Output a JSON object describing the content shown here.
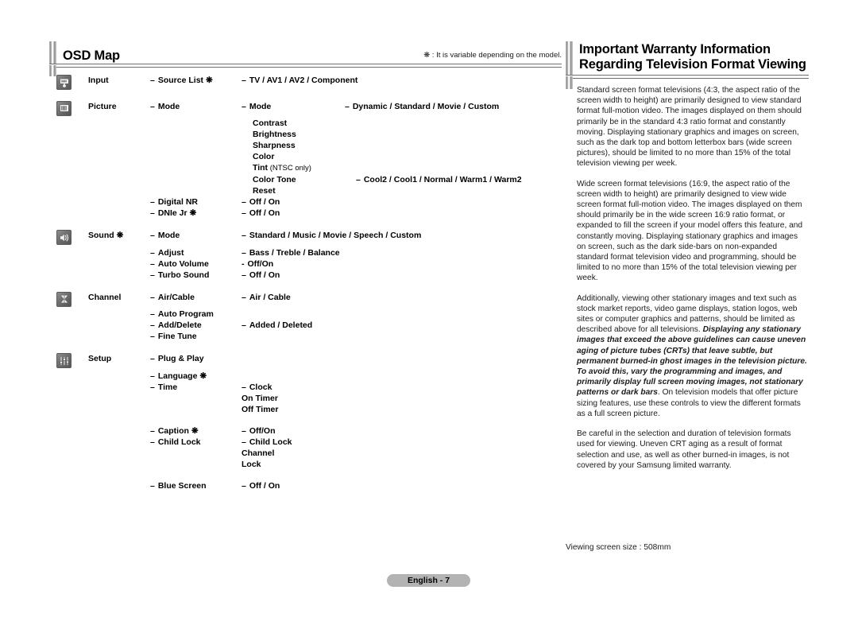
{
  "left": {
    "title": "OSD Map",
    "note": "❋ : It is variable depending on the model.",
    "sections": [
      {
        "icon": "input-connector-icon",
        "category": "Input",
        "rows": [
          {
            "l1": "Source List ❋",
            "l2": "TV / AV1 / AV2 / Component",
            "l3": ""
          }
        ]
      },
      {
        "icon": "picture-screen-icon",
        "category": "Picture",
        "rows": [
          {
            "l1": "Mode",
            "l2": "Mode",
            "l3": "Dynamic / Standard / Movie / Custom"
          },
          {
            "l1": "",
            "l2": "Contrast",
            "l3": ""
          },
          {
            "l1": "",
            "l2": "Brightness",
            "l3": ""
          },
          {
            "l1": "",
            "l2": "Sharpness",
            "l3": ""
          },
          {
            "l1": "",
            "l2": "Color",
            "l3": ""
          },
          {
            "l1": "",
            "l2": "Tint",
            "l2_note": " (NTSC only)",
            "l3": ""
          },
          {
            "l1": "",
            "l2": "Color Tone",
            "l3": "Cool2 / Cool1 / Normal / Warm1 / Warm2"
          },
          {
            "l1": "",
            "l2": "Reset",
            "l3": ""
          },
          {
            "l1": "Digital NR",
            "l2": "Off / On",
            "l3": ""
          },
          {
            "l1": "DNIe Jr ❋",
            "l2": "Off / On",
            "l3": ""
          }
        ]
      },
      {
        "icon": "speaker-sound-icon",
        "category": "Sound ❋",
        "rows": [
          {
            "l1": "Mode",
            "l2": "Standard / Music / Movie / Speech / Custom",
            "l3": ""
          },
          {
            "l1": "Adjust",
            "l2": "Bass / Treble / Balance",
            "l3": ""
          },
          {
            "l1": "Auto Volume",
            "l2": "Off/On",
            "dash2": "-",
            "l3": ""
          },
          {
            "l1": "Turbo Sound",
            "l2": "Off / On",
            "l3": ""
          }
        ]
      },
      {
        "icon": "antenna-channel-icon",
        "category": "Channel",
        "rows": [
          {
            "l1": "Air/Cable",
            "l2": "Air / Cable",
            "l3": ""
          },
          {
            "l1": "Auto Program",
            "l2": "",
            "l3": ""
          },
          {
            "l1": "Add/Delete",
            "l2": "Added / Deleted",
            "l3": ""
          },
          {
            "l1": "Fine Tune",
            "l2": "",
            "l3": ""
          }
        ]
      },
      {
        "icon": "sliders-setup-icon",
        "category": "Setup",
        "rows": [
          {
            "l1": "Plug & Play",
            "l2": "",
            "l3": ""
          },
          {
            "l1": "Language ❋",
            "l2": "",
            "l3": ""
          },
          {
            "l1": "Time",
            "l2": "Clock",
            "l3": ""
          },
          {
            "l1": "",
            "l2": "On Timer",
            "l3": ""
          },
          {
            "l1": "",
            "l2": "Off Timer",
            "l3": ""
          },
          {
            "l1": "Caption ❋",
            "l2": "Off/On",
            "l3": ""
          },
          {
            "l1": "Child Lock",
            "l2": "Child Lock",
            "l3": ""
          },
          {
            "l1": "",
            "l2": "Channel",
            "l3": ""
          },
          {
            "l1": "",
            "l2": "Lock",
            "l3": ""
          },
          {
            "l1": "Blue Screen",
            "l2": "Off / On",
            "l3": ""
          }
        ]
      }
    ]
  },
  "right": {
    "title": "Important Warranty Information\nRegarding Television Format Viewing",
    "paragraphs": [
      {
        "parts": [
          {
            "text": "Standard screen format televisions (4:3, the aspect ratio of the screen width to height) are primarily designed to view standard format full-motion video. The images displayed on them should primarily be in the standard 4:3 ratio format and constantly moving. Displaying stationary graphics and images on screen, such as the dark top and bottom letterbox bars (wide screen pictures), should be limited to no more than 15% of the total television viewing per week.",
            "style": "normal"
          }
        ]
      },
      {
        "parts": [
          {
            "text": "Wide screen format televisions (16:9, the aspect ratio of the screen width to height) are primarily designed to view wide screen format full-motion video. The images displayed on them should primarily be in the wide screen 16:9 ratio format, or expanded to fill the screen if your model offers this feature, and constantly moving. Displaying stationary graphics and images on screen, such as the dark side-bars on non-expanded standard format television video and programming, should be limited to no more than 15% of the total television viewing per week.",
            "style": "normal"
          }
        ]
      },
      {
        "parts": [
          {
            "text": "Additionally, viewing other stationary images and text such as stock market reports, video game displays, station logos, web sites or computer graphics and patterns, should be limited as described above for all televisions. ",
            "style": "normal"
          },
          {
            "text": "Displaying any stationary images that exceed the above guidelines can cause uneven aging of picture tubes (CRTs) that leave subtle, but permanent burned-in ghost images in the television picture. To avoid this, vary the programming and images, and primarily display full screen moving images, not stationary patterns or dark bars",
            "style": "bold-italic"
          },
          {
            "text": ". On television models that offer picture sizing features, use these controls to view the different formats as a full screen picture.",
            "style": "normal"
          }
        ]
      },
      {
        "parts": [
          {
            "text": "Be careful in the selection and duration of television formats used for viewing. Uneven CRT aging as a result of format selection and use, as well as other burned-in images, is not covered by your Samsung limited warranty.",
            "style": "normal"
          }
        ]
      }
    ],
    "screen_size": "Viewing screen size : 508mm"
  },
  "footer": {
    "page_label": "English - 7"
  }
}
